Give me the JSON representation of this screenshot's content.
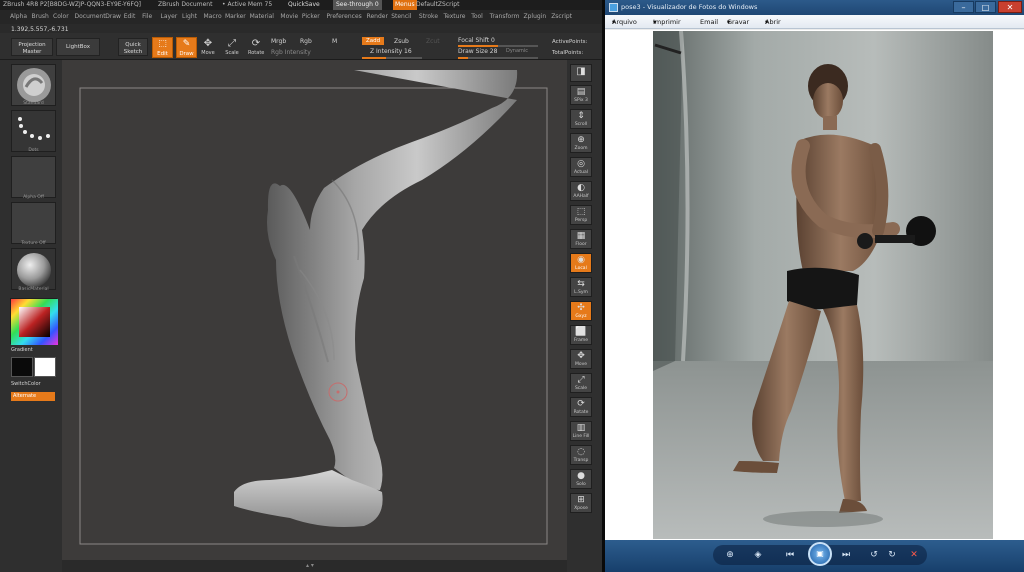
{
  "zbrush": {
    "title_bar": {
      "app": "ZBrush 4R8",
      "build": "P2[B8DG-WZJP-QQN3-EY9E-Y6FQ]",
      "document": "ZBrush Document",
      "mem": "• Active Mem 75",
      "quicksave": "QuickSave",
      "see_through": "See-through 0",
      "menus": "Menus",
      "script": "DefaultZScript"
    },
    "menus": [
      "Alpha",
      "Brush",
      "Color",
      "Document",
      "Draw",
      "Edit",
      "File",
      "Layer",
      "Light",
      "Macro",
      "Marker",
      "Material",
      "Movie",
      "Picker",
      "Preferences",
      "Render",
      "Stencil",
      "Stroke",
      "Texture",
      "Tool",
      "Transform",
      "Zplugin",
      "Zscript"
    ],
    "coords": "1.392,5.557,-6.731",
    "top_shelf": {
      "projection_master": "Projection Master",
      "lightbox": "LightBox",
      "quick_sketch": "Quick Sketch",
      "edit": "Edit",
      "draw": "Draw",
      "move": "Move",
      "scale": "Scale",
      "rotate": "Rotate",
      "mrgb": "Mrgb",
      "rgb": "Rgb",
      "m": "M",
      "rgb_intensity": "Rgb Intensity",
      "zadd": "Zadd",
      "zsub": "Zsub",
      "zcut": "Zcut",
      "z_intensity": "Z Intensity 16",
      "focal_shift": "Focal Shift 0",
      "draw_size": "Draw Size 28",
      "dynamic": "Dynamic",
      "active_points": "ActivePoints:",
      "total_points": "TotalPoints:"
    },
    "left_shelf": {
      "brush_caption": "Standard",
      "stroke_caption": "Dots",
      "alpha_caption": "Alpha Off",
      "texture_caption": "Texture Off",
      "material_caption": "BasicMaterial",
      "gradient": "Gradient",
      "switch_color": "SwitchColor",
      "alternate": "Alternate"
    },
    "right_shelf": [
      "SPix 3",
      "Scroll",
      "Zoom",
      "Actual",
      "AAHalf",
      "Persp",
      "Floor",
      "Local",
      "L.Sym",
      "Gxyz",
      "Frame",
      "Move",
      "Scale",
      "Rotate",
      "Line Fill",
      "Transp",
      "Solo",
      "Xpose"
    ],
    "colors": {
      "accent": "#e67a1a",
      "panel": "#2f2f2f",
      "canvas": "#3d3b3a"
    }
  },
  "viewer": {
    "title": "pose3 - Visualizador de Fotos do Windows",
    "menu": [
      "Arquivo",
      "Imprimir",
      "Email",
      "Gravar",
      "Abrir"
    ],
    "controls": [
      "zoom-icon",
      "actual-size-icon",
      "previous-icon",
      "slideshow-icon",
      "next-icon",
      "rotate-left-icon",
      "rotate-right-icon",
      "delete-icon"
    ],
    "colors": {
      "titlebar": "#1f4774",
      "close": "#c8402f"
    }
  }
}
